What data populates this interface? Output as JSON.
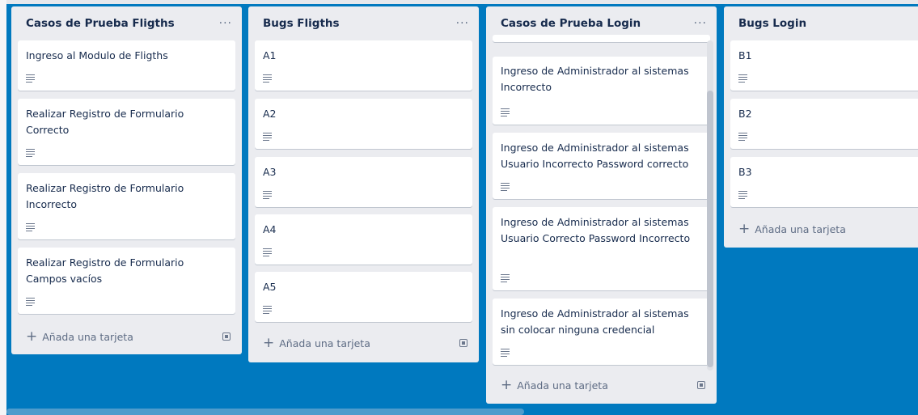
{
  "lists": [
    {
      "title": "Casos de Prueba Fligths",
      "menu": "···",
      "cards": [
        "Ingreso al Modulo de Fligths",
        "Realizar Registro de Formulario Correcto",
        "Realizar Registro de Formulario Incorrecto",
        "Realizar Registro de Formulario Campos vacíos"
      ],
      "add_label": "Añada una tarjeta"
    },
    {
      "title": "Bugs Fligths",
      "menu": "···",
      "cards": [
        "A1",
        "A2",
        "A3",
        "A4",
        "A5"
      ],
      "add_label": "Añada una tarjeta"
    },
    {
      "title": "Casos de Prueba Login",
      "menu": "···",
      "cards": [
        "Ingreso de Administrador al sistemas Incorrecto",
        "Ingreso de Administrador al sistemas Usuario Incorrecto Password correcto",
        "Ingreso de Administrador al sistemas Usuario Correcto Password Incorrecto",
        "Ingreso de Administrador al sistemas sin colocar ninguna credencial"
      ],
      "add_label": "Añada una tarjeta"
    },
    {
      "title": "Bugs Login",
      "menu": "···",
      "cards": [
        "B1",
        "B2",
        "B3"
      ],
      "add_label": "Añada una tarjeta"
    }
  ],
  "icons": {
    "description": "text-lines-icon",
    "add": "plus-icon",
    "template": "card-template-icon"
  }
}
